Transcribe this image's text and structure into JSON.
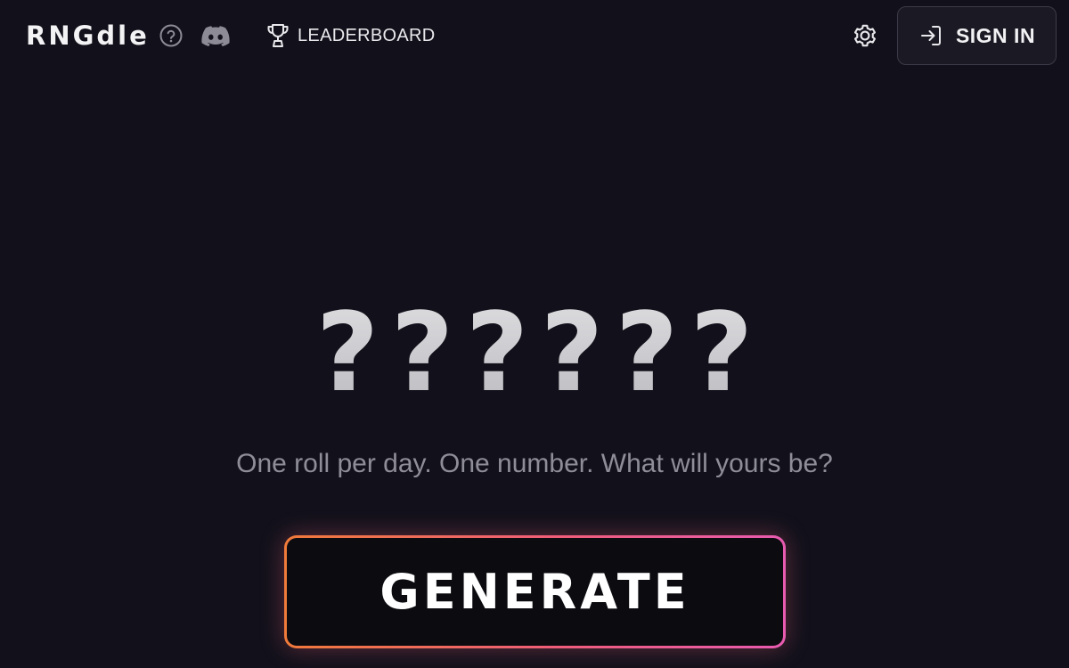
{
  "app": {
    "title": "RNGdle"
  },
  "header": {
    "help_icon": "help-circle-icon",
    "discord_icon": "discord-icon",
    "leaderboard": {
      "label": "LEADERBOARD",
      "icon": "trophy-icon"
    },
    "settings_icon": "gear-icon",
    "signin": {
      "label": "SIGN IN",
      "icon": "login-arrow-icon"
    }
  },
  "hero": {
    "digits": [
      "?",
      "?",
      "?",
      "?",
      "?",
      "?"
    ],
    "tagline": "One roll per day. One number. What will yours be?",
    "generate_label": "GENERATE"
  },
  "colors": {
    "background": "#12111b",
    "gradient_start": "#f07a3a",
    "gradient_end": "#e85bb0"
  }
}
